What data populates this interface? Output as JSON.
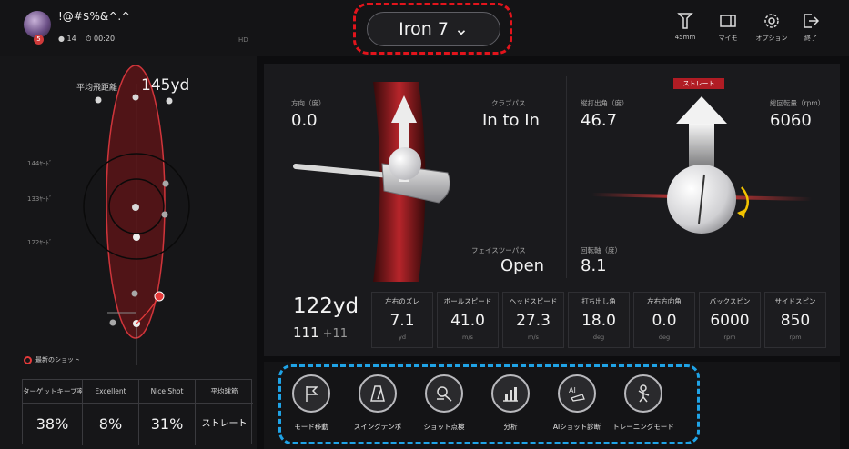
{
  "user": {
    "name": "!@#$%&^.^",
    "badge": "5",
    "level": "● 14",
    "time": "⏱ 00:20",
    "hd": "HD"
  },
  "club": {
    "label": "Iron 7"
  },
  "toolbar": [
    {
      "id": "tee",
      "label": "45mm"
    },
    {
      "id": "myset",
      "label": "マイモ"
    },
    {
      "id": "options",
      "label": "オプション"
    },
    {
      "id": "exit",
      "label": "終了"
    }
  ],
  "trajectory": {
    "title": "平均飛距離",
    "value": "145yd",
    "ylabels": [
      "144ﾔｰﾄﾞ",
      "133ﾔｰﾄﾞ",
      "122ﾔｰﾄﾞ"
    ],
    "legend": "最新のショット"
  },
  "percent_table": {
    "headers": [
      "ターゲットキープ率",
      "Excellent",
      "Nice Shot",
      "平均球筋"
    ],
    "values": [
      "38%",
      "8%",
      "31%",
      "ストレート"
    ]
  },
  "shot": {
    "club_face": {
      "label": "方向（度）",
      "value": "0.0"
    },
    "club_path": {
      "label": "クラブパス",
      "value": "In to In"
    },
    "face_to_path": {
      "label": "フェイスツーパス",
      "value": "Open"
    },
    "launch": {
      "label": "縦打出角（度）",
      "value": "46.7"
    },
    "spin_rate": {
      "label": "総回転量（rpm）",
      "value": "6060"
    },
    "spin_axis": {
      "label": "回転軸（度）",
      "value": "8.1"
    },
    "ball_flight": "ストレート"
  },
  "summary": {
    "carry": "122yd",
    "run": "111",
    "run_extra": "+11"
  },
  "cells": [
    {
      "header": "左右のズレ",
      "value": "7.1",
      "unit": "yd"
    },
    {
      "header": "ボールスピード",
      "value": "41.0",
      "unit": "m/s"
    },
    {
      "header": "ヘッドスピード",
      "value": "27.3",
      "unit": "m/s"
    },
    {
      "header": "打ち出し角",
      "value": "18.0",
      "unit": "deg"
    },
    {
      "header": "左右方向角",
      "value": "0.0",
      "unit": "deg"
    },
    {
      "header": "バックスピン",
      "value": "6000",
      "unit": "rpm"
    },
    {
      "header": "サイドスピン",
      "value": "850",
      "unit": "rpm"
    }
  ],
  "dock": [
    {
      "id": "mode",
      "label": "モード移動"
    },
    {
      "id": "tempo",
      "label": "スイングテンポ"
    },
    {
      "id": "check",
      "label": "ショット点検"
    },
    {
      "id": "analysis",
      "label": "分析"
    },
    {
      "id": "ai",
      "label": "AIショット診断"
    },
    {
      "id": "training",
      "label": "トレーニングモード"
    }
  ]
}
